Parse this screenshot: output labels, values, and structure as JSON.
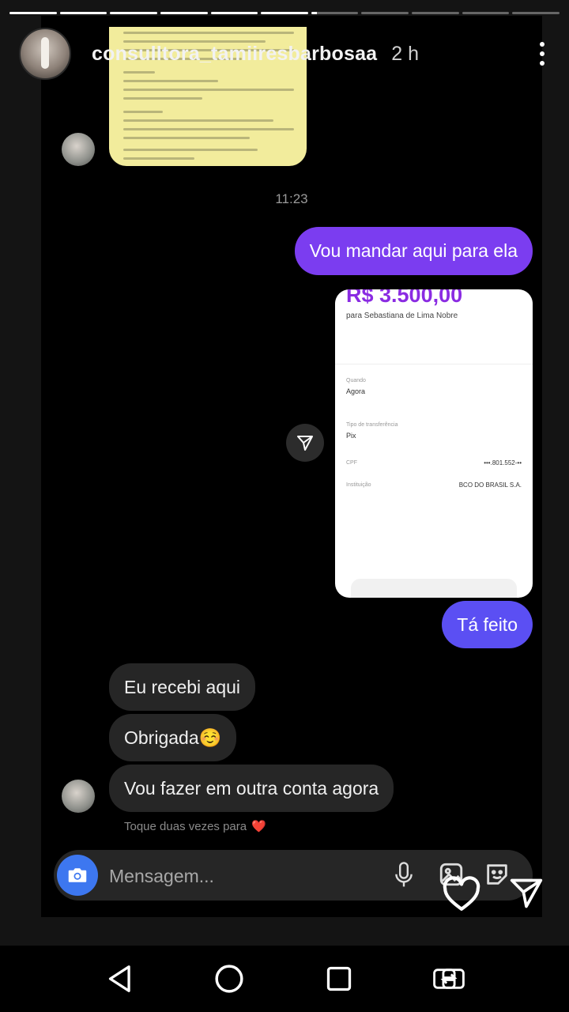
{
  "story": {
    "segments": 11,
    "current_segment": 7,
    "username": "consulltora_tamiiresbarbosaa",
    "time_ago": "2 h"
  },
  "chat": {
    "timestamp": "11:23",
    "sent_1": "Vou mandar aqui para ela",
    "receipt": {
      "amount": "R$ 3.500,00",
      "recipient": "para Sebastiana de Lima Nobre",
      "when_label": "Quando",
      "when_value": "Agora",
      "type_label": "Tipo de transferência",
      "type_value": "Pix",
      "cpf_label": "CPF",
      "cpf_value": "•••.801.552-••",
      "institution_label": "Instituição",
      "institution_value": "BCO DO BRASIL S.A."
    },
    "sent_2": "Tá feito",
    "received": [
      "Eu recebi aqui",
      "Obrigada☺️",
      "Vou fazer em outra conta agora"
    ],
    "hint": "Toque duas vezes para",
    "hint_emoji": "❤️",
    "composer_placeholder": "Mensagem..."
  },
  "icons": {
    "camera": "camera-icon",
    "mic": "microphone-icon",
    "gallery": "gallery-icon",
    "sticker": "sticker-icon",
    "like": "heart-icon",
    "share": "send-icon"
  }
}
